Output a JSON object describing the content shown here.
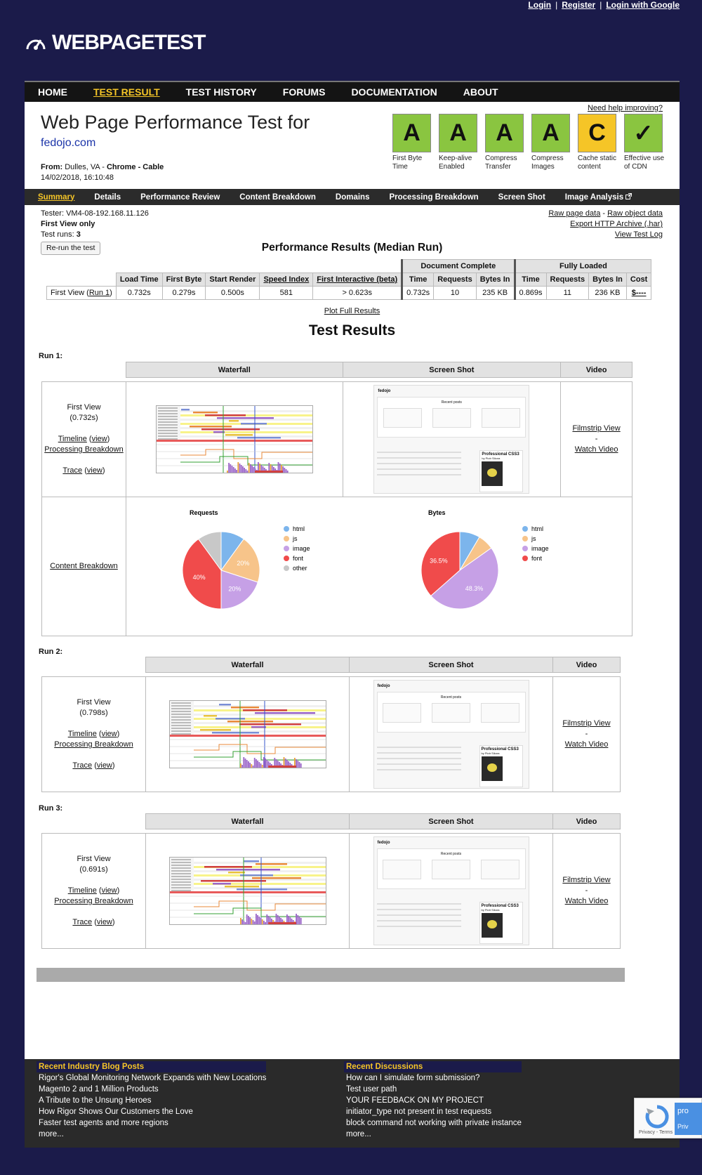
{
  "top_links": [
    "Login",
    "Register",
    "Login with Google"
  ],
  "logo": "WEBPAGETEST",
  "nav": [
    "HOME",
    "TEST RESULT",
    "TEST HISTORY",
    "FORUMS",
    "DOCUMENTATION",
    "ABOUT"
  ],
  "nav_active": "TEST RESULT",
  "header": {
    "title": "Web Page Performance Test for",
    "url": "fedojo.com",
    "from_label": "From:",
    "from": "Dulles, VA - ",
    "browser": "Chrome - Cable",
    "date": "14/02/2018, 16:10:48",
    "help": "Need help improving?"
  },
  "grades": [
    {
      "grade": "A",
      "label": "First Byte Time",
      "color": "#8ac540"
    },
    {
      "grade": "A",
      "label": "Keep-alive Enabled",
      "color": "#8ac540"
    },
    {
      "grade": "A",
      "label": "Compress Transfer",
      "color": "#8ac540"
    },
    {
      "grade": "A",
      "label": "Compress Images",
      "color": "#8ac540"
    },
    {
      "grade": "C",
      "label": "Cache static content",
      "color": "#f5c527"
    },
    {
      "grade": "✓",
      "label": "Effective use of CDN",
      "color": "#8ac540"
    }
  ],
  "subnav": [
    "Summary",
    "Details",
    "Performance Review",
    "Content Breakdown",
    "Domains",
    "Processing Breakdown",
    "Screen Shot",
    "Image Analysis"
  ],
  "tester": {
    "tester": "Tester: VM4-08-192.168.11.126",
    "first_view": "First View only",
    "runs_label": "Test runs: ",
    "runs": "3",
    "rerun": "Re-run the test"
  },
  "raw_links": {
    "raw_page": "Raw page data",
    "dash": " - ",
    "raw_object": "Raw object data",
    "har": "Export HTTP Archive (.har)",
    "log": "View Test Log"
  },
  "perf": {
    "title": "Performance Results (Median Run)",
    "doc_complete": "Document Complete",
    "fully_loaded": "Fully Loaded",
    "cols": [
      "Load Time",
      "First Byte",
      "Start Render",
      "Speed Index",
      "First Interactive (beta)",
      "Time",
      "Requests",
      "Bytes In",
      "Time",
      "Requests",
      "Bytes In",
      "Cost"
    ],
    "row_label": "First View (",
    "row_link": "Run 1",
    "row_end": ")",
    "values": [
      "0.732s",
      "0.279s",
      "0.500s",
      "581",
      "> 0.623s",
      "0.732s",
      "10",
      "235 KB",
      "0.869s",
      "11",
      "236 KB",
      "$----"
    ],
    "plot": "Plot Full Results"
  },
  "results_title": "Test Results",
  "col_heads": {
    "waterfall": "Waterfall",
    "shot": "Screen Shot",
    "video": "Video"
  },
  "runs": [
    {
      "label": "Run 1:",
      "fv": "First View",
      "time": "(0.732s)"
    },
    {
      "label": "Run 2:",
      "fv": "First View",
      "time": "(0.798s)"
    },
    {
      "label": "Run 3:",
      "fv": "First View",
      "time": "(0.691s)"
    }
  ],
  "links": {
    "timeline": "Timeline",
    "view": "view",
    "processing": "Processing Breakdown",
    "trace": "Trace",
    "filmstrip": "Filmstrip View",
    "dash": "-",
    "watch": "Watch Video",
    "content": "Content Breakdown"
  },
  "shot_text": {
    "brand": "fedojo",
    "recent": "Recent posts",
    "book": "Professional CSS3",
    "author": "by Piotr Sikora"
  },
  "chart_data": [
    {
      "type": "pie",
      "title": "Requests",
      "categories": [
        "html",
        "js",
        "image",
        "font",
        "other"
      ],
      "values": [
        10,
        20,
        20,
        40,
        10
      ],
      "slice_labels": [
        "",
        "20%",
        "20%",
        "40%",
        ""
      ],
      "colors": [
        "#7cb5ec",
        "#f7c48a",
        "#c6a0e6",
        "#f04b4b",
        "#c8c8c8"
      ]
    },
    {
      "type": "pie",
      "title": "Bytes",
      "categories": [
        "html",
        "js",
        "image",
        "font"
      ],
      "values": [
        8.5,
        6.7,
        48.3,
        36.5
      ],
      "slice_labels": [
        "",
        "",
        "48.3%",
        "36.5%"
      ],
      "colors": [
        "#7cb5ec",
        "#f7c48a",
        "#c6a0e6",
        "#f04b4b"
      ]
    }
  ],
  "footer": {
    "blog_title": "Recent Industry Blog Posts",
    "blog": [
      "Rigor's Global Monitoring Network Expands with New Locations",
      "Magento 2 and 1 Million Products",
      "A Tribute to the Unsung Heroes",
      "How Rigor Shows Our Customers the Love",
      "Faster test agents and more regions",
      "more..."
    ],
    "disc_title": "Recent Discussions",
    "disc": [
      "How can I simulate form submission?",
      "Test user path",
      "YOUR FEEDBACK ON MY PROJECT",
      "initiator_type not present in test requests",
      "block command not working with private instance",
      "more..."
    ]
  },
  "recaptcha": {
    "brand": "pro",
    "sub": "Priv",
    "links": "Privacy - Terms"
  }
}
